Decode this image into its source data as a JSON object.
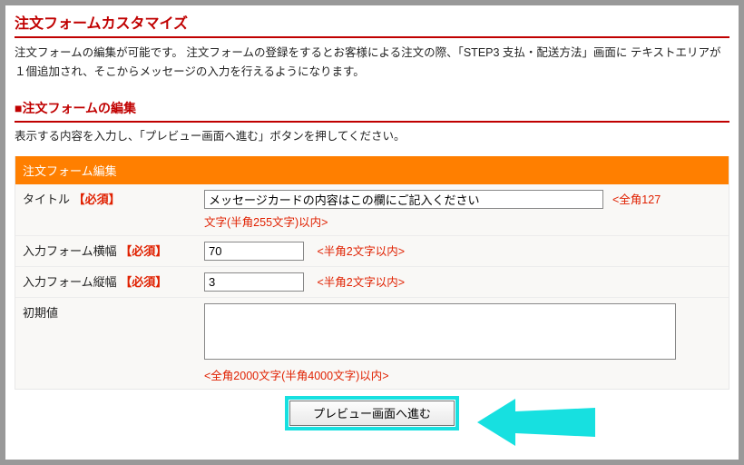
{
  "page": {
    "title": "注文フォームカスタマイズ",
    "intro": "注文フォームの編集が可能です。 注文フォームの登録をするとお客様による注文の際、「STEP3 支払・配送方法」画面に テキストエリアが１個追加され、そこからメッセージの入力を行えるようになります。",
    "section_title": "■注文フォームの編集",
    "section_desc": "表示する内容を入力し、「プレビュー画面へ進む」ボタンを押してください。"
  },
  "panel": {
    "header": "注文フォーム編集",
    "required_marker": "【必須】"
  },
  "fields": {
    "title": {
      "label": "タイトル",
      "value": "メッセージカードの内容はこの欄にご記入ください",
      "hint_right": "<全角127",
      "hint_below": "文字(半角255文字)以内>"
    },
    "width": {
      "label": "入力フォーム横幅",
      "value": "70",
      "hint": "<半角2文字以内>"
    },
    "height": {
      "label": "入力フォーム縦幅",
      "value": "3",
      "hint": "<半角2文字以内>"
    },
    "initial": {
      "label": "初期値",
      "value": "",
      "hint": "<全角2000文字(半角4000文字)以内>"
    }
  },
  "actions": {
    "submit_label": "プレビュー画面へ進む"
  },
  "arrow": {
    "color": "#17e0e0"
  }
}
